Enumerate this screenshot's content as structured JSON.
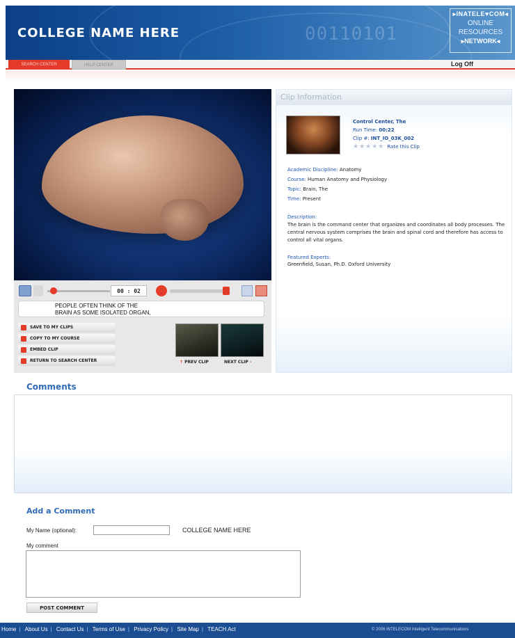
{
  "header": {
    "college_name": "COLLEGE NAME HERE",
    "binary_decoration": "00110101",
    "logo": {
      "top": "▸INATELE♥COM◂",
      "line1": "ONLINE",
      "line2": "RESOURCES",
      "bottom": "▸NETWORK◂"
    }
  },
  "nav": {
    "tabs": [
      {
        "label": "SEARCH CENTER",
        "active": true
      },
      {
        "label": "HELP CENTER",
        "active": false
      }
    ],
    "log_off": "Log Off"
  },
  "player": {
    "time": "00 : 02",
    "caption_line1": "PEOPLE OFTEN THINK OF THE",
    "caption_line2": "BRAIN AS SOME ISOLATED ORGAN,",
    "actions": [
      "SAVE TO MY CLIPS",
      "COPY TO MY COURSE",
      "EMBED CLIP",
      "RETURN TO SEARCH CENTER"
    ],
    "prev_clip": "PREV CLIP",
    "next_clip": "NEXT CLIP",
    "progress_fraction": 0.05,
    "volume_fraction": 0.95
  },
  "clip_info": {
    "heading": "Clip Information",
    "title": "Control Center, The",
    "run_time_label": "Run Time:",
    "run_time": "00:22",
    "clip_no_label": "Clip #:",
    "clip_no": "INT_IO_03K_002",
    "rating_stars": "★★★★★",
    "rate_label": "Rate this Clip",
    "academic_label": "Academic Discipline:",
    "academic": "Anatomy",
    "course_label": "Course:",
    "course": "Human Anatomy and Physiology",
    "topic_label": "Topic:",
    "topic": "Brain, The",
    "time_label": "Time:",
    "time": "Present",
    "description_label": "Description:",
    "description": "The brain is the command center that organizes and coordinates all body processes. The central nervous system comprises the brain and spinal cord and therefore has access to control all vital organs.",
    "experts_label": "Featured Experts:",
    "experts": "Greenfield, Susan, Ph.D. Oxford University"
  },
  "comments": {
    "title": "Comments",
    "add_title": "Add a Comment",
    "name_label": "My Name (optional):",
    "name_value": "",
    "college_text": "COLLEGE NAME HERE",
    "comment_label": "My comment",
    "comment_value": "",
    "post_label": "POST COMMENT"
  },
  "footer": {
    "links": [
      "Home",
      "About Us",
      "Contact Us",
      "Terms of Use",
      "Privacy Policy",
      "Site Map",
      "TEACH Act"
    ],
    "copyright": "© 2006 INTELECOM Intelligent Telecommunications"
  },
  "colors": {
    "accent_red": "#e43a2a",
    "header_blue": "#0b3f86",
    "link_blue": "#1d57b3",
    "footer_blue": "#1b4d92"
  }
}
